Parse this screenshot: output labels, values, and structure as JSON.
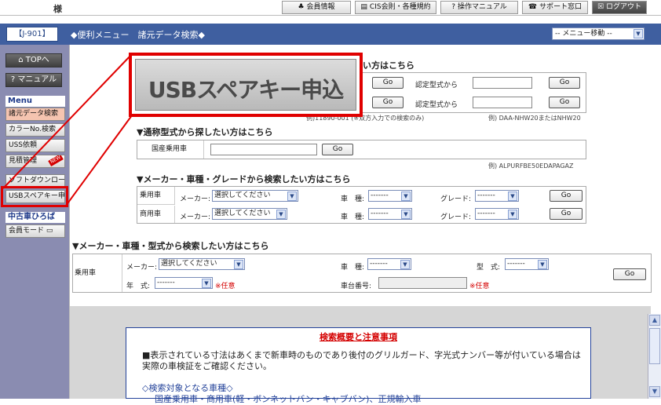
{
  "topbar": {
    "user_suffix": "様",
    "buttons": [
      {
        "label": "会員情報",
        "icon": "club-icon"
      },
      {
        "label": "CIS会則・各種規約",
        "icon": "list-icon"
      },
      {
        "label": "操作マニュアル",
        "icon": "help-icon"
      },
      {
        "label": "サポート窓口",
        "icon": "phone-icon"
      },
      {
        "label": "ログアウト",
        "icon": "close-box-icon"
      }
    ]
  },
  "header": {
    "page_code": "【J-901】",
    "title": "◆便利メニュー　諸元データ検索◆",
    "menu_select": "-- メニュー移動 --"
  },
  "sidebar": {
    "top_button": "TOPへ",
    "manual_button": "マニュアル",
    "menu_heading": "Menu",
    "menu_items": [
      "諸元データ検索",
      "カラーNo.検索",
      "USS依頼",
      "見積管理"
    ],
    "new_badge": "NEW",
    "download_item": "ソフトダウンロード",
    "usb_item": "USBスペアキー申込",
    "used_car_heading": "中古車ひろば",
    "member_mode": "会員モード"
  },
  "zoom_callout": {
    "text": "USBスペアキー申込"
  },
  "section1": {
    "heading_tail": "い方はこちら",
    "go": "Go",
    "approval_label": "認定型式から",
    "example_left": "例)11890-001 (※双方入力での検索のみ)",
    "example_right": "例) DAA-NHW20またはNHW20"
  },
  "section2": {
    "heading": "▼通称型式から探したい方はこちら",
    "row_label": "国産乗用車",
    "go": "Go",
    "example": "例) ALPURFBE50EDAPAGAZ"
  },
  "section3": {
    "heading": "▼メーカー・車種・グレードから検索したい方はこちら",
    "rows": [
      {
        "label": "乗用車"
      },
      {
        "label": "商用車"
      }
    ],
    "maker_label": "メーカー:",
    "maker_value": "選択してください",
    "model_label": "車　種:",
    "model_value": "-------",
    "grade_label": "グレード:",
    "grade_value": "-------",
    "go": "Go"
  },
  "section4": {
    "heading": "▼メーカー・車種・型式から検索したい方はこちら",
    "row_label": "乗用車",
    "maker_label": "メーカー:",
    "maker_value": "選択してください",
    "model_label": "車　種:",
    "model_value": "-------",
    "type_label": "型　式:",
    "type_value": "-------",
    "year_label": "年　式:",
    "year_value": "-------",
    "optional_mark": "※任意",
    "chassis_label": "車台番号:",
    "go": "Go"
  },
  "notice": {
    "title": "検索概要と注意事項",
    "body": "■表示されている寸法はあくまで新車時のものであり後付のグリルガード、字光式ナンバー等が付いている場合は実際の車検証をご確認ください。",
    "sub": "◇検索対象となる車種◇",
    "sub2": "国産乗用車・商用車(軽・ボンネットバン・キャブバン)、正規輸入車"
  },
  "colors": {
    "highlight": "#e00000",
    "header_blue": "#3f5fa0",
    "sidebar": "#8a8cb1"
  }
}
